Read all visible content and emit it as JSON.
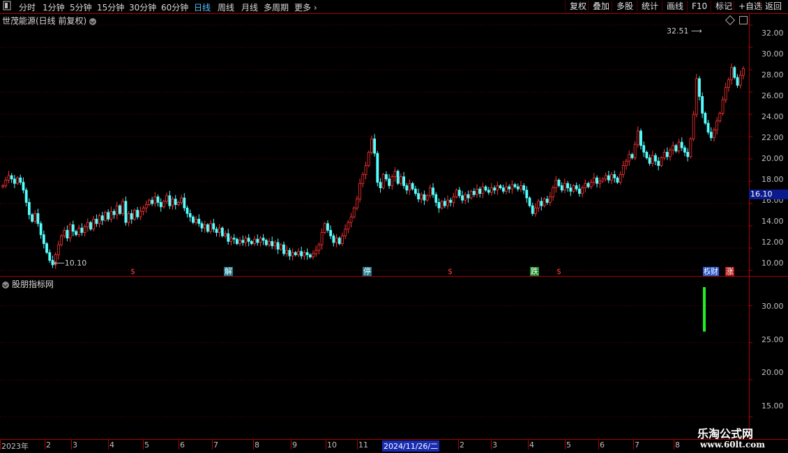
{
  "toolbar": {
    "periods": [
      "分时",
      "1分钟",
      "5分钟",
      "15分钟",
      "30分钟",
      "60分钟",
      "日线",
      "周线",
      "月线",
      "多周期",
      "更多"
    ],
    "active_period": "日线",
    "buttons": [
      "复权",
      "叠加",
      "多股",
      "统计",
      "画线",
      "F10",
      "标记",
      "+自选",
      "返回"
    ]
  },
  "main_chart": {
    "title": "世茂能源(日线 前复权)",
    "y_ticks": [
      "32.00",
      "30.00",
      "28.00",
      "26.00",
      "24.00",
      "22.00",
      "20.00",
      "18.00",
      "16.00",
      "14.00",
      "12.00",
      "10.00"
    ],
    "current_price": "16.10",
    "high_annotation": "32.51",
    "low_annotation": "10.10",
    "signals": [
      {
        "text": "$",
        "color": "#ff3a3a",
        "bg": "#000000"
      },
      {
        "text": "解",
        "color": "#ffffff",
        "bg": "#1e7a8a"
      },
      {
        "text": "停",
        "color": "#ffffff",
        "bg": "#1e7a8a"
      },
      {
        "text": "$",
        "color": "#ff3a3a",
        "bg": "#000000"
      },
      {
        "text": "跌",
        "color": "#ffffff",
        "bg": "#1f8a2a"
      },
      {
        "text": "$",
        "color": "#ff3a3a",
        "bg": "#000000"
      },
      {
        "text": "权",
        "color": "#ffffff",
        "bg": "#2c58c8"
      },
      {
        "text": "财",
        "color": "#ffffff",
        "bg": "#2c58c8"
      },
      {
        "text": "涨",
        "color": "#ffffff",
        "bg": "#b01a1a"
      }
    ]
  },
  "indicator_panel": {
    "title": "股朋指标网",
    "y_ticks": [
      "30.00",
      "25.00",
      "20.00",
      "15.00"
    ]
  },
  "date_axis": {
    "labels": [
      "2023年",
      "2",
      "3",
      "4",
      "5",
      "6",
      "7",
      "8",
      "9",
      "10",
      "11",
      "2",
      "3",
      "4",
      "5",
      "6",
      "7",
      "8"
    ],
    "cursor_date": "2024/11/26/二"
  },
  "watermark": {
    "line1": "乐淘公式网",
    "line2": "www.60lt.com"
  },
  "colors": {
    "up": "#ff3232",
    "down": "#54ffff",
    "grid": "#7a0000",
    "axis": "#b00000",
    "indicator_bar": "#22ee22"
  },
  "chart_data": {
    "type": "candlestick",
    "ylim": [
      9.5,
      33.0
    ],
    "indicator_ylim": [
      12.0,
      34.0
    ],
    "closes": [
      17.6,
      18.1,
      18.5,
      18.2,
      17.8,
      18.3,
      17.9,
      17.2,
      16.1,
      15.0,
      14.4,
      15.1,
      14.2,
      13.2,
      12.4,
      11.6,
      10.9,
      10.5,
      11.4,
      12.3,
      13.1,
      13.6,
      12.9,
      14.1,
      13.5,
      13.2,
      13.8,
      13.4,
      13.9,
      14.3,
      13.7,
      14.6,
      14.2,
      14.9,
      14.5,
      15.2,
      14.6,
      15.3,
      15.0,
      15.8,
      15.1,
      16.2,
      14.3,
      15.1,
      14.6,
      15.4,
      14.8,
      15.3,
      15.6,
      15.9,
      16.3,
      16.0,
      16.6,
      16.1,
      15.7,
      16.2,
      16.7,
      15.8,
      16.4,
      15.9,
      16.1,
      16.5,
      15.6,
      15.1,
      14.8,
      14.3,
      14.6,
      14.2,
      13.8,
      14.1,
      13.5,
      14.2,
      13.7,
      13.4,
      13.8,
      13.1,
      13.3,
      12.6,
      12.9,
      12.8,
      12.4,
      12.7,
      12.5,
      12.9,
      12.6,
      12.4,
      12.8,
      12.5,
      12.9,
      12.7,
      12.3,
      12.6,
      12.2,
      12.5,
      11.9,
      12.3,
      11.5,
      11.8,
      11.3,
      11.6,
      11.4,
      11.7,
      11.3,
      11.6,
      11.4,
      11.2,
      11.5,
      11.8,
      12.3,
      13.4,
      14.2,
      13.6,
      13.1,
      12.5,
      12.9,
      12.4,
      13.1,
      13.7,
      14.3,
      14.8,
      15.6,
      16.4,
      17.8,
      18.6,
      19.4,
      20.6,
      21.8,
      20.5,
      17.9,
      17.4,
      18.6,
      18.2,
      17.6,
      18.4,
      18.9,
      17.8,
      18.4,
      17.6,
      17.2,
      17.8,
      17.3,
      16.9,
      16.4,
      16.8,
      16.3,
      16.7,
      17.4,
      16.8,
      16.1,
      15.6,
      16.2,
      15.8,
      16.3,
      16.1,
      16.6,
      17.2,
      16.7,
      16.3,
      16.8,
      16.5,
      17.1,
      16.8,
      17.3,
      16.9,
      17.5,
      17.2,
      17.0,
      17.4,
      17.2,
      17.6,
      17.4,
      17.1,
      17.5,
      17.3,
      17.7,
      17.5,
      17.3,
      17.6,
      17.2,
      16.5,
      15.8,
      15.1,
      15.6,
      16.2,
      15.8,
      16.4,
      16.1,
      16.6,
      17.4,
      18.1,
      17.6,
      17.2,
      17.8,
      17.4,
      17.1,
      17.6,
      17.3,
      16.9,
      17.4,
      17.8,
      17.5,
      17.9,
      18.3,
      17.8,
      18.0,
      18.2,
      18.5,
      18.1,
      18.6,
      18.3,
      17.9,
      18.6,
      19.4,
      19.8,
      20.4,
      20.1,
      21.3,
      22.5,
      21.2,
      20.6,
      20.1,
      19.6,
      20.3,
      19.8,
      19.4,
      20.1,
      20.6,
      20.2,
      20.8,
      21.2,
      20.7,
      21.5,
      21.0,
      20.6,
      20.2,
      21.8,
      24.0,
      27.2,
      25.6,
      24.1,
      23.2,
      22.4,
      21.9,
      22.6,
      23.4,
      24.1,
      25.3,
      26.4,
      27.1,
      28.2,
      27.3,
      26.6,
      27.5,
      28.1
    ]
  }
}
